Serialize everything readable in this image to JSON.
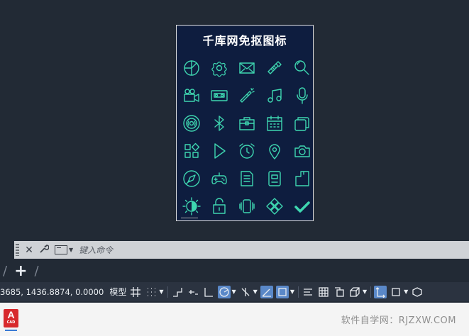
{
  "sheet": {
    "title": "千库网免抠图标",
    "icons": [
      "pie-chart-icon",
      "settings-icon",
      "mail-icon",
      "usb-drive-icon",
      "search-icon",
      "video-camera-icon",
      "cassette-icon",
      "flashlight-icon",
      "music-note-icon",
      "microphone-icon",
      "signal-icon",
      "bluetooth-icon",
      "briefcase-icon",
      "calendar-icon",
      "cards-icon",
      "apps-icon",
      "play-icon",
      "alarm-clock-icon",
      "location-pin-icon",
      "camera-icon",
      "compass-icon",
      "gamepad-icon",
      "document-icon",
      "robot-icon",
      "sd-card-icon",
      "brightness-icon",
      "lock-icon",
      "vibrate-icon",
      "puzzle-icon",
      "checkmark-icon"
    ],
    "icon_color": "#3ed6b0",
    "background": "#0e1d3f"
  },
  "command_line": {
    "placeholder": "键入命令",
    "close_glyph": "✕"
  },
  "tabs": {
    "add_glyph": "+"
  },
  "status_bar": {
    "coordinates": "3685, 1436.8874, 0.0000",
    "model_label": "模型"
  },
  "taskbar": {
    "app_icon_text": "A",
    "app_icon_caption": "CAD",
    "watermark": "软件自学网：RJZXW.COM"
  }
}
